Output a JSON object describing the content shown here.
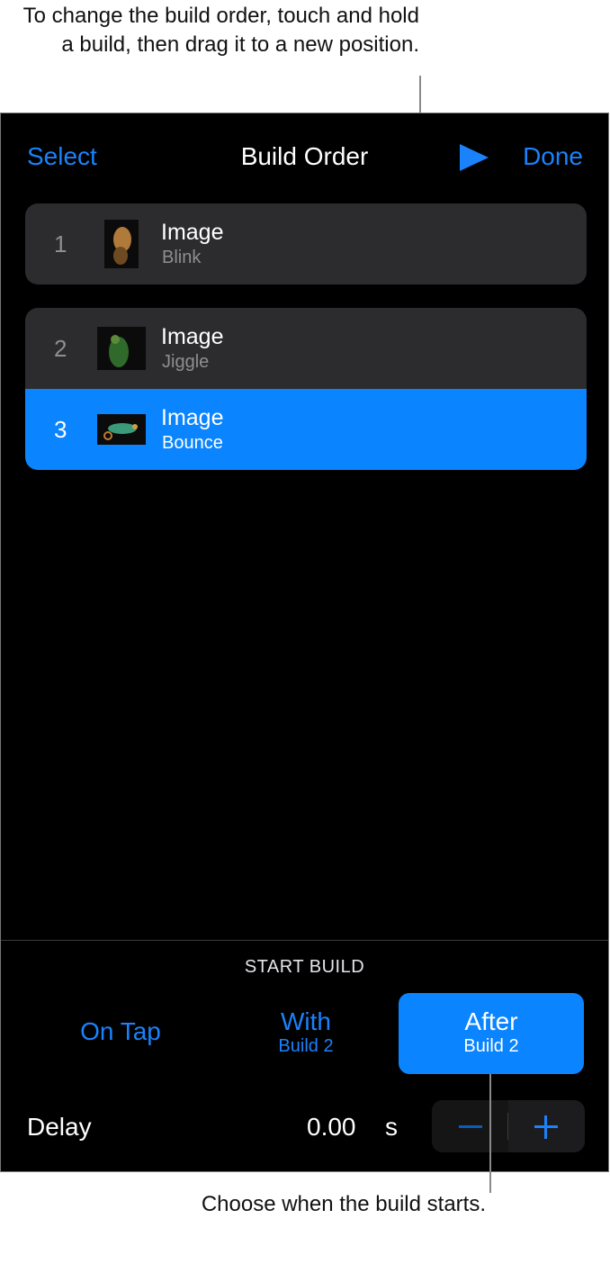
{
  "annotations": {
    "top": "To change the build order, touch and hold a build, then drag it to a new position.",
    "bottom": "Choose when the build starts."
  },
  "nav": {
    "select": "Select",
    "title": "Build Order",
    "play_icon": "play-icon",
    "done": "Done"
  },
  "builds": [
    {
      "number": "1",
      "name": "Image",
      "effect": "Blink",
      "thumbnail": "leopard-image",
      "selected": false
    },
    {
      "number": "2",
      "name": "Image",
      "effect": "Jiggle",
      "thumbnail": "parrot-image",
      "selected": false
    },
    {
      "number": "3",
      "name": "Image",
      "effect": "Bounce",
      "thumbnail": "chameleon-image",
      "selected": true
    }
  ],
  "start_build": {
    "label": "START BUILD",
    "options": [
      {
        "main": "On Tap",
        "sub": ""
      },
      {
        "main": "With",
        "sub": "Build 2"
      },
      {
        "main": "After",
        "sub": "Build 2"
      }
    ],
    "selected": "After"
  },
  "delay": {
    "label": "Delay",
    "value": "0.00",
    "unit": "s"
  },
  "colors": {
    "accent": "#0a84ff",
    "row_bg": "#2c2c2e",
    "background": "#000000"
  }
}
